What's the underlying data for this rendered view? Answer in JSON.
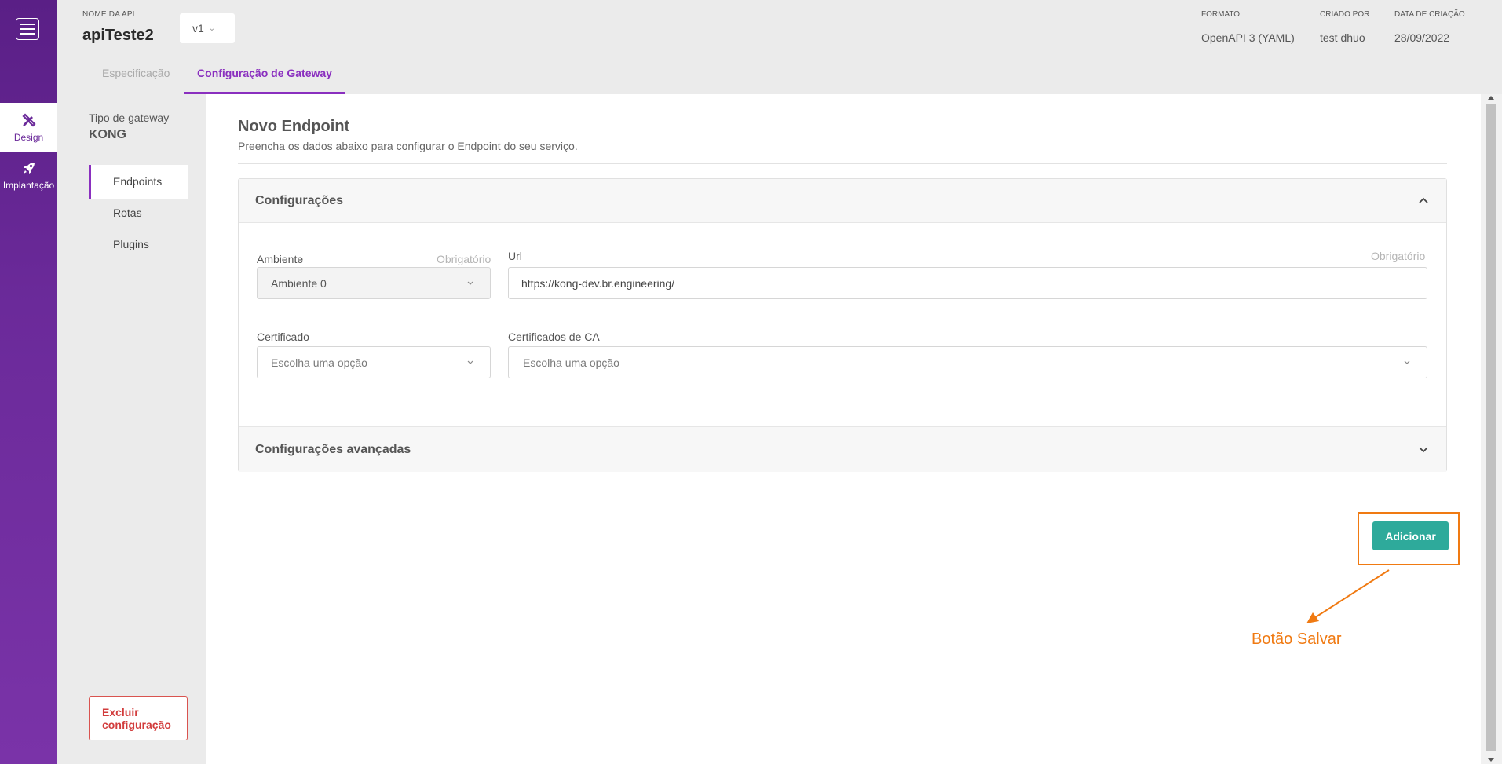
{
  "nav_rail": {
    "items": [
      {
        "label": "Design",
        "icon": "design-pencil-ruler-icon",
        "active": true
      },
      {
        "label": "Implantação",
        "icon": "rocket-icon",
        "active": false
      }
    ]
  },
  "header": {
    "api_label": "NOME DA API",
    "api_name": "apiTeste2",
    "version": "v1",
    "meta": [
      {
        "label": "FORMATO",
        "value": "OpenAPI 3 (YAML)"
      },
      {
        "label": "CRIADO POR",
        "value": "test dhuo"
      },
      {
        "label": "DATA DE CRIAÇÃO",
        "value": "28/09/2022"
      }
    ],
    "tabs": [
      {
        "label": "Especificação",
        "active": false
      },
      {
        "label": "Configuração de Gateway",
        "active": true
      }
    ]
  },
  "subnav": {
    "gateway_type_label": "Tipo de gateway",
    "gateway_type_value": "KONG",
    "items": [
      {
        "label": "Endpoints",
        "active": true
      },
      {
        "label": "Rotas",
        "active": false
      },
      {
        "label": "Plugins",
        "active": false
      }
    ],
    "delete_label": "Excluir configuração"
  },
  "main": {
    "title": "Novo Endpoint",
    "subtitle": "Preencha os dados abaixo para configurar o Endpoint do seu serviço.",
    "config_section": {
      "title": "Configurações",
      "ambiente_label": "Ambiente",
      "ambiente_required": "Obrigatório",
      "ambiente_value": "Ambiente 0",
      "url_label": "Url",
      "url_required": "Obrigatório",
      "url_value": "https://kong-dev.br.engineering/",
      "certificado_label": "Certificado",
      "certificado_placeholder": "Escolha uma opção",
      "ca_label": "Certificados de CA",
      "ca_placeholder": "Escolha uma opção"
    },
    "advanced_section": {
      "title": "Configurações avançadas"
    },
    "add_button": "Adicionar"
  },
  "annotation": {
    "text": "Botão Salvar",
    "color": "#f07a12"
  },
  "colors": {
    "brand_purple": "#6b2a9a",
    "accent_purple": "#8a2fbf",
    "add_button": "#2eaa9b",
    "danger": "#d23c3c"
  }
}
